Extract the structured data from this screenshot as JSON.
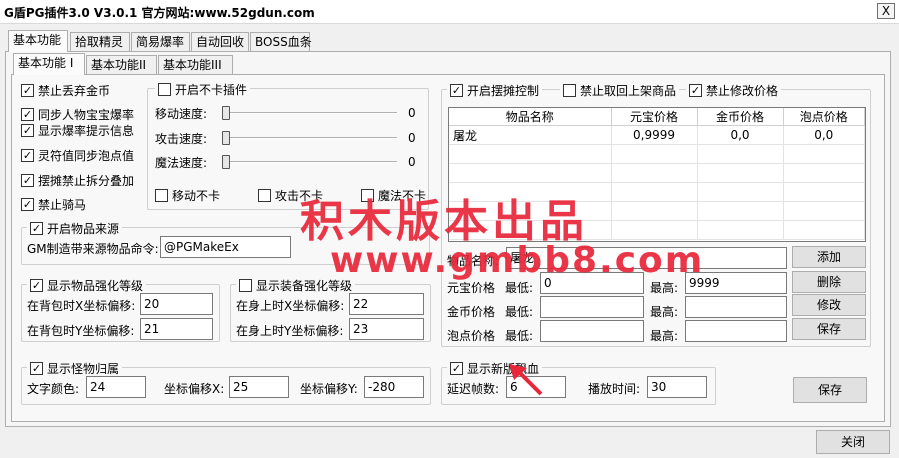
{
  "window": {
    "title": "G盾PG插件3.0 V3.0.1  官方网站:www.52gdun.com",
    "close_glyph": "X"
  },
  "tabs_top": [
    "基本功能",
    "拾取精灵",
    "简易爆率",
    "自动回收",
    "BOSS血条"
  ],
  "tabs_sub": [
    "基本功能 I",
    "基本功能II",
    "基本功能III"
  ],
  "left_checks": [
    {
      "label": "禁止丢弃金币",
      "checked": true
    },
    {
      "label": "同步人物宝宝爆率",
      "checked": true
    },
    {
      "label": "显示爆率提示信息",
      "checked": true
    },
    {
      "label": "灵符值同步泡点值",
      "checked": true
    },
    {
      "label": "摆摊禁止拆分叠加",
      "checked": true
    },
    {
      "label": "禁止骑马",
      "checked": true
    }
  ],
  "kaqia": {
    "title": "开启不卡插件",
    "sliders": [
      {
        "label": "移动速度:",
        "value": "0"
      },
      {
        "label": "攻击速度:",
        "value": "0"
      },
      {
        "label": "魔法速度:",
        "value": "0"
      }
    ],
    "checks": [
      "移动不卡",
      "攻击不卡",
      "魔法不卡"
    ]
  },
  "source": {
    "title": "开启物品来源",
    "cmd_label": "GM制造带来源物品命令:",
    "cmd_value": "@PGMakeEx"
  },
  "strengthen": {
    "title": "显示物品强化等级",
    "x_label": "在背包时X坐标偏移:",
    "x_value": "20",
    "y_label": "在背包时Y坐标偏移:",
    "y_value": "21"
  },
  "equip": {
    "title": "显示装备强化等级",
    "x_label": "在身上时X坐标偏移:",
    "x_value": "22",
    "y_label": "在身上时Y坐标偏移:",
    "y_value": "23"
  },
  "monster": {
    "title": "显示怪物归属",
    "color_label": "文字颜色:",
    "color_value": "24",
    "x_label": "坐标偏移X:",
    "x_value": "25",
    "y_label": "坐标偏移Y:",
    "y_value": "-280"
  },
  "stall": {
    "enable_label": "开启摆摊控制",
    "no_take_label": "禁止取回上架商品",
    "no_modify_label": "禁止修改价格",
    "columns": [
      "物品名称",
      "元宝价格",
      "金币价格",
      "泡点价格"
    ],
    "rows": [
      [
        "屠龙",
        "0,9999",
        "0,0",
        "0,0"
      ]
    ],
    "item_label": "物品名称:",
    "item_value": "屠龙",
    "yb_label": "元宝价格",
    "gold_label": "金币价格",
    "pd_label": "泡点价格",
    "min_label": "最低:",
    "max_label": "最高:",
    "yb_min": "0",
    "yb_max": "9999",
    "buttons": [
      "添加",
      "删除",
      "修改",
      "保存"
    ]
  },
  "blood": {
    "title": "显示新版飘血",
    "delay_label": "延迟帧数:",
    "delay_value": "6",
    "time_label": "播放时间:",
    "time_value": "30"
  },
  "save_label": "保存",
  "close_label": "关闭",
  "watermark": {
    "line1": "积木版本出品",
    "line2": "www.gmbb8.com"
  }
}
